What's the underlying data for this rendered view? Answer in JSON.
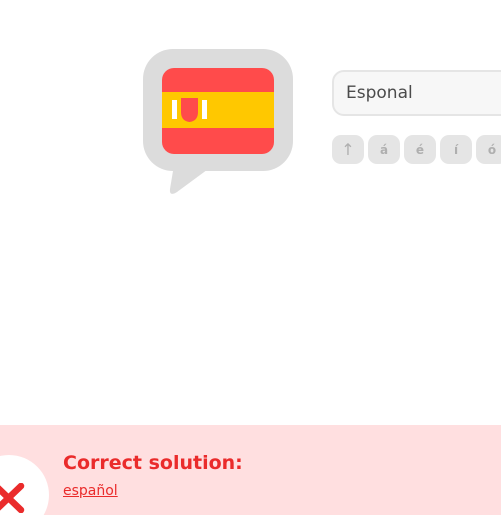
{
  "exercise": {
    "flag_icon": "spain-flag-speech-bubble-icon",
    "answer_value": "Esponal",
    "special_chars": [
      "↑",
      "á",
      "é",
      "í",
      "ó"
    ]
  },
  "feedback": {
    "status_icon": "x-icon",
    "title": "Correct solution:",
    "solution": "español",
    "colors": {
      "banner_background": "#ffdfe0",
      "text": "#ea2b2b",
      "icon": "#ea2b2b"
    }
  }
}
